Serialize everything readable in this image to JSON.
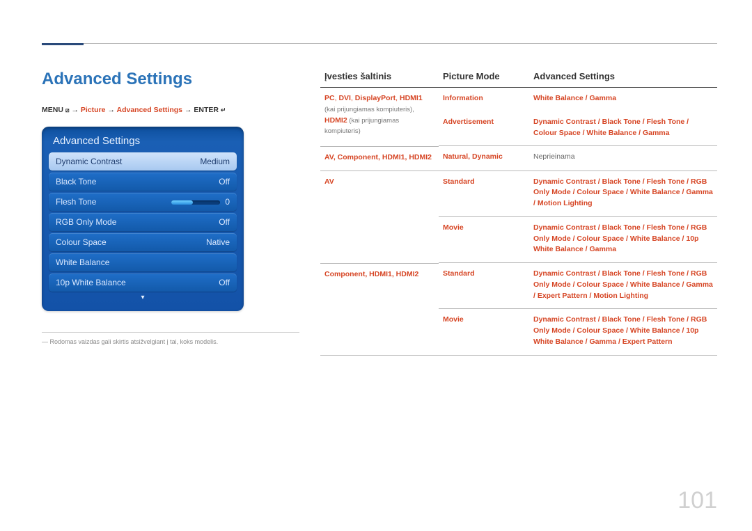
{
  "page_number": "101",
  "section_title": "Advanced Settings",
  "breadcrumb": {
    "menu_label": "MENU",
    "menu_icon": "⧄",
    "arrow": "→",
    "p1": "Picture",
    "p2": "Advanced Settings",
    "enter_label": "ENTER",
    "enter_icon": "↵"
  },
  "osd": {
    "title": "Advanced Settings",
    "rows": [
      {
        "label": "Dynamic Contrast",
        "value": "Medium",
        "selected": true
      },
      {
        "label": "Black Tone",
        "value": "Off"
      },
      {
        "label": "Flesh Tone",
        "value": "0",
        "slider": true
      },
      {
        "label": "RGB Only Mode",
        "value": "Off"
      },
      {
        "label": "Colour Space",
        "value": "Native"
      },
      {
        "label": "White Balance",
        "value": ""
      },
      {
        "label": "10p White Balance",
        "value": "Off"
      }
    ],
    "arrow_down": "▾"
  },
  "footnote": "Rodomas vaizdas gali skirtis atsižvelgiant į tai, koks modelis.",
  "table": {
    "headers": [
      "Įvesties šaltinis",
      "Picture Mode",
      "Advanced Settings"
    ],
    "rows": [
      {
        "c1_hl": "PC",
        "c1_sep1": ", ",
        "c1_hl2": "DVI",
        "c1_sep2": ", ",
        "c1_hl3": "DisplayPort",
        "c1_sep3": ", ",
        "c1_hl4": "HDMI1",
        "c1_note1": "(kai prijungiamas kompiuteris), ",
        "c1_hl5": "HDMI2",
        "c1_note2": " (kai prijungiamas kompiuteris)",
        "c2a": "Information",
        "c3a": "White Balance / Gamma",
        "c2b": "Advertisement",
        "c3b": "Dynamic Contrast / Black Tone / Flesh Tone / Colour Space / White Balance / Gamma"
      },
      {
        "c1": "AV, Component, HDMI1, HDMI2",
        "c2": "Natural, Dynamic",
        "c3_plain": "Neprieinama"
      },
      {
        "c1": "AV",
        "c2a": "Standard",
        "c3a": "Dynamic Contrast / Black Tone / Flesh Tone / RGB Only Mode / Colour Space / White Balance / Gamma / Motion Lighting",
        "c2b": "Movie",
        "c3b": "Dynamic Contrast / Black Tone / Flesh Tone / RGB Only Mode / Colour Space / White Balance / 10p White Balance / Gamma"
      },
      {
        "c1": "Component, HDMI1, HDMI2",
        "c2a": "Standard",
        "c3a": "Dynamic Contrast / Black Tone / Flesh Tone / RGB Only Mode / Colour Space / White Balance / Gamma / Expert Pattern / Motion Lighting",
        "c2b": "Movie",
        "c3b": "Dynamic Contrast / Black Tone / Flesh Tone / RGB Only Mode / Colour Space / White Balance / 10p White Balance / Gamma / Expert Pattern"
      }
    ]
  }
}
